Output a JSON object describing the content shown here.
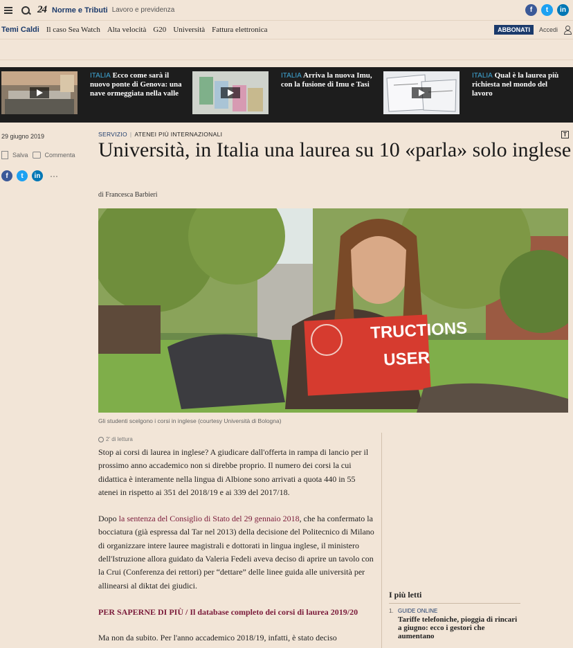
{
  "header": {
    "logo": "24",
    "brand": "Norme e Tributi",
    "subbrand": "Lavoro e previdenza",
    "social": [
      "f",
      "t",
      "in"
    ]
  },
  "nav": {
    "items": [
      "Temi Caldi",
      "Il caso Sea Watch",
      "Alta velocità",
      "G20",
      "Università",
      "Fattura elettronica"
    ],
    "abbonati": "ABBONATI",
    "accedi": "Accedi"
  },
  "videos": [
    {
      "tag": "ITALIA",
      "title": "Ecco come sarà il nuovo ponte di Genova: una nave ormeggiata nella valle"
    },
    {
      "tag": "ITALIA",
      "title": "Arriva la nuova Imu, con la fusione di Imu e Tasi"
    },
    {
      "tag": "ITALIA",
      "title": "Qual è la laurea più richiesta nel mondo del lavoro"
    }
  ],
  "meta": {
    "date": "29 giugno 2019",
    "save": "Salva",
    "comment": "Commenta",
    "more": "···"
  },
  "article": {
    "section": "SERVIZIO",
    "topic": "ATENEI PIÙ INTERNAZIONALI",
    "title": "Università, in Italia una laurea su 10 «parla» solo inglese",
    "byline": "di Francesca Barbieri",
    "caption": "Gli studenti scelgono i corsi in inglese (courtesy Università di Bologna)",
    "reading_time": "2' di lettura",
    "p1": "Stop ai corsi di laurea in inglese? A giudicare dall'offerta in rampa di lancio per il prossimo anno accademico non si direbbe proprio. Il numero dei corsi la cui didattica è interamente nella lingua di Albione sono arrivati a quota 440 in 55 atenei in rispetto ai 351 del 2018/19 e ai 339 del 2017/18.",
    "p2_pre": "Dopo ",
    "p2_link": "la sentenza del Consiglio di Stato del 29 gennaio 2018",
    "p2_post": ", che ha confermato la bocciatura (già espressa dal Tar nel 2013) della decisione del Politecnico di Milano di organizzare intere lauree magistrali e dottorati in lingua inglese, il ministero dell'Istruzione allora guidato da Valeria Fedeli aveva deciso di aprire un tavolo con la Crui (Conferenza dei rettori) per “dettare” delle linee guida alle università per allinearsi al diktat dei giudici.",
    "more_link": "PER SAPERNE DI PIÙ / Il database completo dei corsi di laurea 2019/20",
    "p3": "Ma non da subito. Per l'anno accademico 2018/19, infatti, è stato deciso"
  },
  "sidebar": {
    "title": "I più letti",
    "items": [
      {
        "num": "1.",
        "tag": "GUIDE ONLINE",
        "headline": "Tariffe telefoniche, pioggia di rincari a giugno: ecco i gestori che aumentano"
      }
    ]
  },
  "photo_book": {
    "line1": "TRUCTIONS",
    "line2": "USER"
  }
}
